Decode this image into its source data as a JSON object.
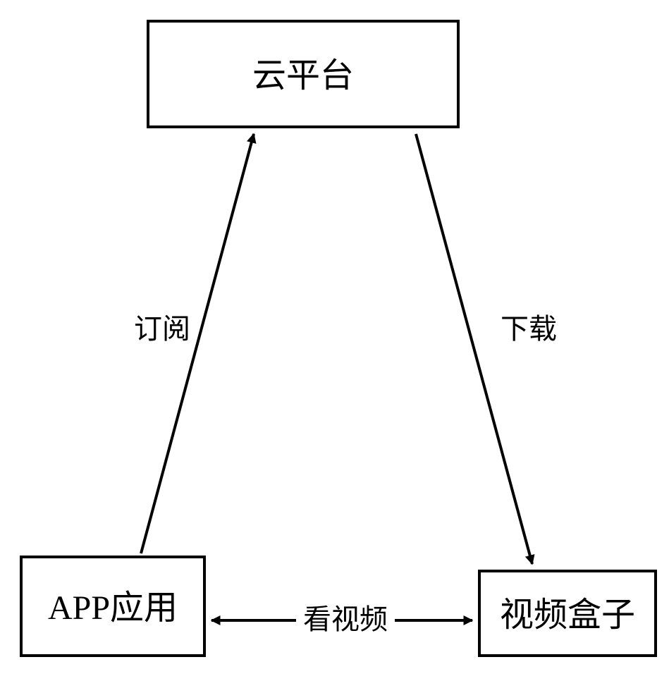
{
  "nodes": {
    "cloud": {
      "label": "云平台"
    },
    "app": {
      "label": "APP应用"
    },
    "video": {
      "label": "视频盒子"
    }
  },
  "edges": {
    "subscribe": {
      "label": "订阅"
    },
    "download": {
      "label": "下载"
    },
    "watch": {
      "label": "看视频"
    }
  }
}
